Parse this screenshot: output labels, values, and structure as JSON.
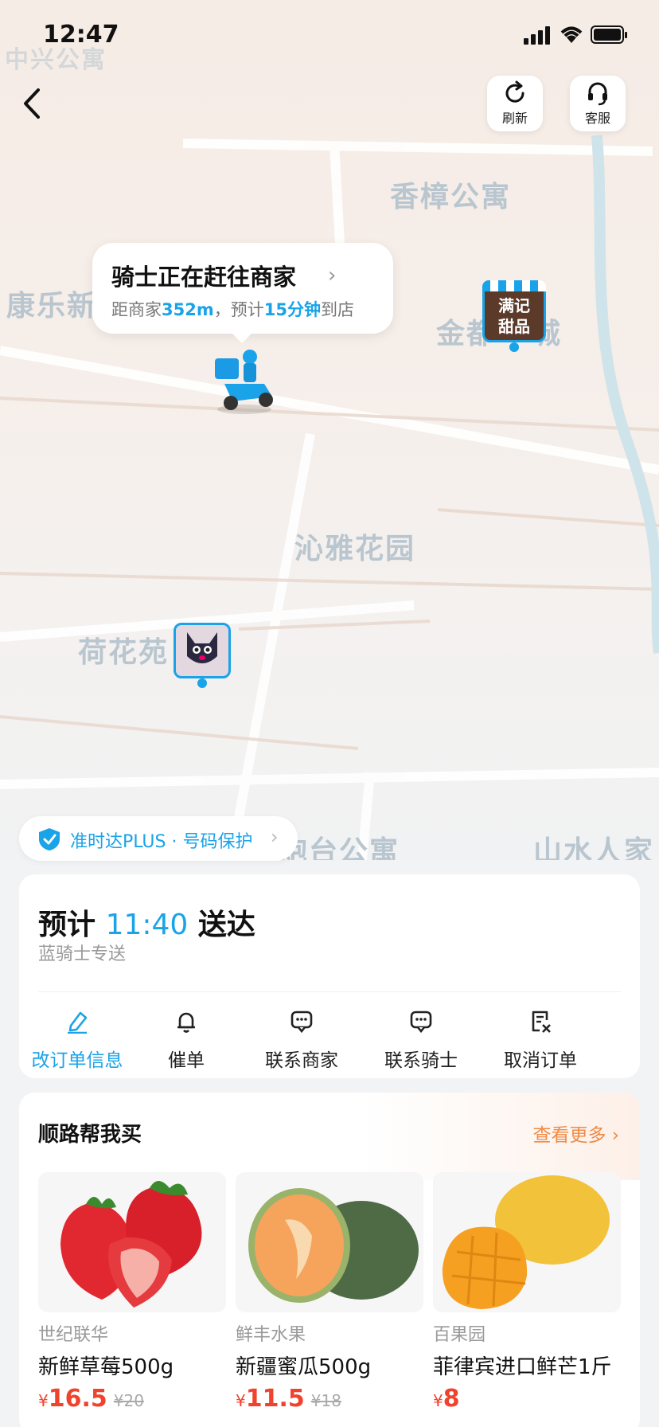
{
  "status_bar": {
    "time": "12:47"
  },
  "header": {
    "refresh_label": "刷新",
    "service_label": "客服"
  },
  "map": {
    "labels": {
      "top_partial": "中兴公寓",
      "xiangzhang": "香樟公寓",
      "kangle": "康乐新",
      "jindu": "金都",
      "jindu_suffix": "城",
      "qinya": "沁雅花园",
      "hehua": "荷花苑",
      "paotai": "炮台公寓",
      "shanshui": "山水人家"
    },
    "store_pin": {
      "line1": "满记",
      "line2": "甜品"
    },
    "rider_bubble": {
      "title": "骑士正在赶往商家",
      "sub_prefix": "距商家",
      "distance": "352m",
      "sub_middle": "，预计",
      "minutes": "15分钟",
      "sub_suffix": "到店"
    }
  },
  "service_badge": {
    "text": "准时达PLUS · 号码保护"
  },
  "eta": {
    "prefix": "预计",
    "time": "11:40",
    "suffix": "送达",
    "courier": "蓝骑士专送"
  },
  "actions": [
    {
      "label": "改订单信息",
      "icon": "edit-icon",
      "active": true
    },
    {
      "label": "催单",
      "icon": "bell-icon",
      "active": false
    },
    {
      "label": "联系商家",
      "icon": "chat-icon",
      "active": false
    },
    {
      "label": "联系骑士",
      "icon": "chat-icon",
      "active": false
    },
    {
      "label": "取消订单",
      "icon": "cancel-order-icon",
      "active": false
    }
  ],
  "shop": {
    "title": "顺路帮我买",
    "more": "查看更多",
    "products": [
      {
        "store": "世纪联华",
        "name": "新鲜草莓500g",
        "currency": "¥",
        "price": "16.5",
        "old_price": "¥20",
        "image": "strawberry"
      },
      {
        "store": "鲜丰水果",
        "name": "新疆蜜瓜500g",
        "currency": "¥",
        "price": "11.5",
        "old_price": "¥18",
        "image": "melon"
      },
      {
        "store": "百果园",
        "name": "菲律宾进口鲜芒1斤",
        "currency": "¥",
        "price": "8",
        "old_price": "",
        "image": "mango"
      }
    ]
  },
  "colors": {
    "accent": "#1aa3e8",
    "price": "#f0432e",
    "more": "#f08a45"
  }
}
